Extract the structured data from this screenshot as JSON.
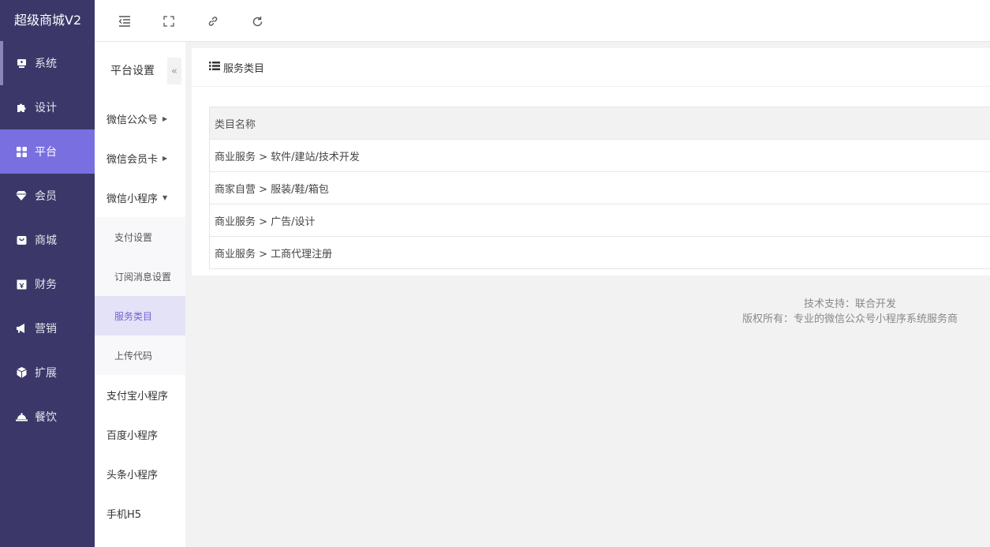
{
  "brand": "超级商城V2",
  "nav": [
    {
      "label": "系统",
      "icon": "monitor-icon"
    },
    {
      "label": "设计",
      "icon": "puzzle-icon"
    },
    {
      "label": "平台",
      "icon": "grid-icon"
    },
    {
      "label": "会员",
      "icon": "gem-icon"
    },
    {
      "label": "商城",
      "icon": "shopping-bag-icon"
    },
    {
      "label": "财务",
      "icon": "yen-icon"
    },
    {
      "label": "营销",
      "icon": "megaphone-icon"
    },
    {
      "label": "扩展",
      "icon": "cube-icon"
    },
    {
      "label": "餐饮",
      "icon": "cloche-icon"
    }
  ],
  "toolbar": [
    "collapse-menu-icon",
    "fullscreen-icon",
    "link-icon",
    "refresh-icon"
  ],
  "subnav": {
    "title": "平台设置",
    "collapse_glyph": "«",
    "items": [
      {
        "label": "微信公众号",
        "caret": "▶"
      },
      {
        "label": "微信会员卡",
        "caret": "▶"
      },
      {
        "label": "微信小程序",
        "caret": "▼"
      },
      {
        "label": "支付宝小程序"
      },
      {
        "label": "百度小程序"
      },
      {
        "label": "头条小程序"
      },
      {
        "label": "手机H5"
      }
    ],
    "children": [
      "支付设置",
      "订阅消息设置",
      "服务类目",
      "上传代码"
    ]
  },
  "panel": {
    "title": "服务类目",
    "table": {
      "header": "类目名称",
      "rows": [
        "商业服务 > 软件/建站/技术开发",
        "商家自营 > 服装/鞋/箱包",
        "商业服务 > 广告/设计",
        "商业服务 > 工商代理注册"
      ]
    }
  },
  "footer": {
    "line1": "技术支持：联合开发",
    "line2": "版权所有：专业的微信公众号小程序系统服务商"
  },
  "colors": {
    "nav_bg": "#3b3869",
    "nav_active": "#7a6fe0",
    "subnav_active_bg": "#e3e2f6",
    "subnav_active_text": "#6f65d8"
  }
}
